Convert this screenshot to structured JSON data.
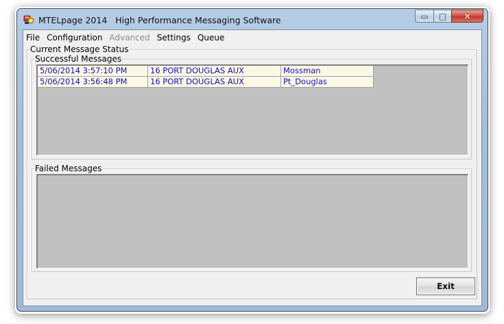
{
  "window": {
    "title": "MTELpage 2014   High Performance Messaging Software",
    "minimize_glyph": "▭",
    "maximize_glyph": "□",
    "close_glyph": "✕"
  },
  "menu": {
    "items": [
      {
        "label": "File",
        "enabled": true
      },
      {
        "label": "Configuration",
        "enabled": true
      },
      {
        "label": "Advanced",
        "enabled": false
      },
      {
        "label": "Settings",
        "enabled": true
      },
      {
        "label": "Queue",
        "enabled": true
      }
    ]
  },
  "status_group": {
    "title": "Current Message Status"
  },
  "successful": {
    "title": "Successful Messages",
    "rows": [
      [
        "5/06/2014 3:57:10 PM",
        "16 PORT DOUGLAS AUX",
        "Mossman"
      ],
      [
        "5/06/2014 3:56:48 PM",
        "16 PORT DOUGLAS AUX",
        "Pt_Douglas"
      ]
    ]
  },
  "failed": {
    "title": "Failed Messages",
    "rows": []
  },
  "exit_button": {
    "label": "Exit"
  },
  "colors": {
    "grid_background": "#c0c0c0",
    "row_background": "#fdf8e6",
    "row_text": "#1010c8",
    "close_button": "#c23a29"
  },
  "icons": {
    "app": "mtelpage-app-icon"
  }
}
